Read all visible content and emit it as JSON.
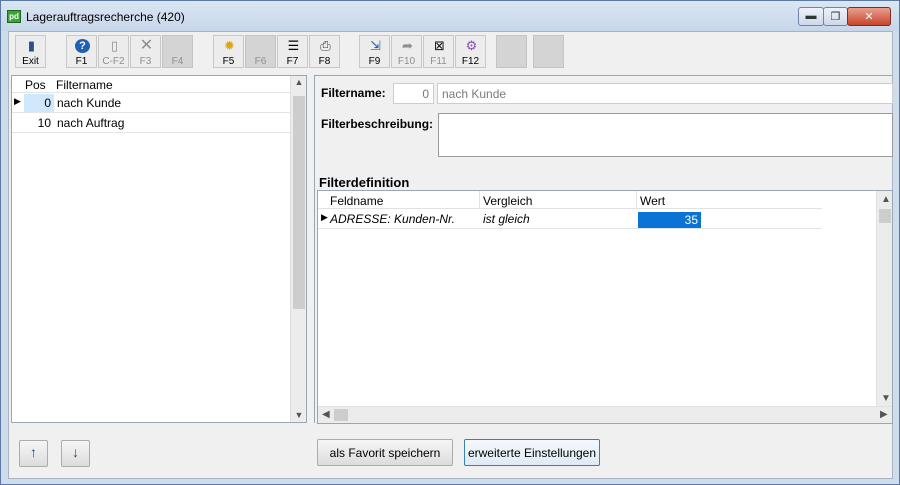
{
  "window": {
    "title": "Lagerauftragsrecherche (420)",
    "app_icon_text": "pd",
    "min_symbol": "▬",
    "max_symbol": "❐",
    "close_symbol": "✕"
  },
  "toolbar": {
    "buttons": [
      {
        "label": "Exit",
        "icon": "exit-door-icon",
        "glyph": "▮",
        "enabled": true
      },
      {
        "label": "F1",
        "icon": "help-icon",
        "glyph": "?",
        "enabled": true
      },
      {
        "label": "C-F2",
        "icon": "new-document-icon",
        "glyph": "▯",
        "enabled": false
      },
      {
        "label": "F3",
        "icon": "delete-x-icon",
        "glyph": "✕",
        "enabled": false
      },
      {
        "label": "F4",
        "icon": "blank-icon",
        "glyph": "",
        "enabled": false
      },
      {
        "label": "F5",
        "icon": "lightbulb-icon",
        "glyph": "✹",
        "enabled": true
      },
      {
        "label": "F6",
        "icon": "blank-icon",
        "glyph": "",
        "enabled": false
      },
      {
        "label": "F7",
        "icon": "list-icon",
        "glyph": "☰",
        "enabled": true
      },
      {
        "label": "F8",
        "icon": "printer-icon",
        "glyph": "⎙",
        "enabled": true
      },
      {
        "label": "F9",
        "icon": "export-icon",
        "glyph": "⇲",
        "enabled": true
      },
      {
        "label": "F10",
        "icon": "forward-icon",
        "glyph": "➦",
        "enabled": false
      },
      {
        "label": "F11",
        "icon": "excel-icon",
        "glyph": "⊠",
        "enabled": false
      },
      {
        "label": "F12",
        "icon": "user-settings-icon",
        "glyph": "⚙",
        "enabled": true
      }
    ]
  },
  "filter_list": {
    "col_pos": "Pos",
    "col_name": "Filtername",
    "rows": [
      {
        "pos": "0",
        "name": "nach Kunde",
        "selected": true
      },
      {
        "pos": "10",
        "name": "nach Auftrag",
        "selected": false
      }
    ]
  },
  "detail": {
    "filtername_label": "Filtername:",
    "filtername_num": "0",
    "filtername_value": "nach Kunde",
    "filterbeschreibung_label": "Filterbeschreibung:",
    "filterdefinition_label": "Filterdefinition"
  },
  "grid": {
    "columns": [
      "Feldname",
      "Vergleich",
      "Wert"
    ],
    "rows": [
      {
        "feldname": "ADRESSE: Kunden-Nr.",
        "vergleich": "ist gleich",
        "wert": "35"
      }
    ]
  },
  "bottom": {
    "up_arrow": "↑",
    "down_arrow": "↓",
    "favorit_label": "als Favorit speichern",
    "erweitert_label": "erweiterte Einstellungen"
  },
  "colors": {
    "selection_blue": "#0a74d6",
    "selected_pos_bg": "#cfe8fb"
  }
}
